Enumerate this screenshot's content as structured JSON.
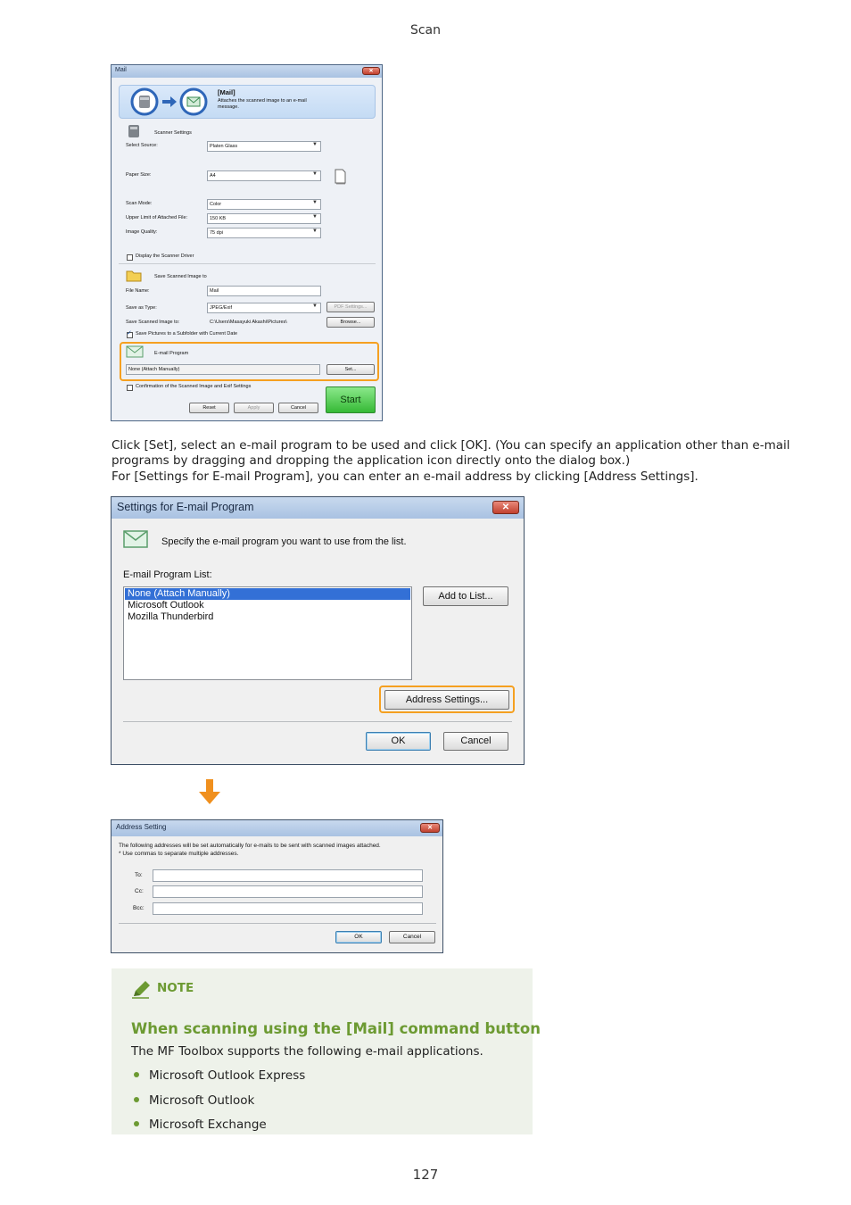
{
  "header": {
    "section": "Scan"
  },
  "mail_dialog": {
    "title": "Mail",
    "close_glyph": "✕",
    "banner_title": "[Mail]",
    "banner_desc_1": "Attaches the scanned image to an e-mail",
    "banner_desc_2": "message.",
    "scanner_settings": "Scanner Settings",
    "select_source_label": "Select Source:",
    "select_source_value": "Platen Glass",
    "paper_size_label": "Paper Size:",
    "paper_size_value": "A4",
    "scan_mode_label": "Scan Mode:",
    "scan_mode_value": "Color",
    "upper_limit_label": "Upper Limit of Attached File:",
    "upper_limit_value": "150 KB",
    "image_quality_label": "Image Quality:",
    "image_quality_value": "75 dpi",
    "display_driver_label": "Display the Scanner Driver",
    "save_scanned_header": "Save Scanned Image to",
    "file_name_label": "File Name:",
    "file_name_value": "Mail",
    "save_as_type_label": "Save as Type:",
    "save_as_type_value": "JPEG/Exif",
    "pdf_settings_button": "PDF Settings...",
    "save_to_label": "Save Scanned Image to:",
    "save_to_value": "C:\\Users\\Masayuki Akashi\\Pictures\\",
    "browse_button": "Browse...",
    "subfolder_label": "Save Pictures to a Subfolder with Current Date",
    "email_program_header": "E-mail Program",
    "email_program_value": "None (Attach Manually)",
    "set_button": "Set...",
    "confirmation_label": "Confirmation of the Scanned Image and Exif Settings",
    "start_button": "Start",
    "reset_button": "Reset",
    "apply_button": "Apply",
    "cancel_button": "Cancel"
  },
  "instructions": {
    "line1": "Click [Set], select an e-mail program to be used and click [OK]. (You can specify an application other than e-mail",
    "line2": "programs by dragging and dropping the application icon directly onto the dialog box.)",
    "line3": "For [Settings for E-mail Program], you can enter an e-mail address by clicking [Address Settings]."
  },
  "settings_dialog": {
    "title": "Settings for E-mail Program",
    "close_glyph": "✕",
    "prompt": "Specify the e-mail program you want to use from the list.",
    "list_label": "E-mail Program List:",
    "programs": [
      "None (Attach Manually)",
      "Microsoft Outlook",
      "Mozilla Thunderbird"
    ],
    "add_to_list_button": "Add to List...",
    "address_settings_button": "Address Settings...",
    "ok_button": "OK",
    "cancel_button": "Cancel"
  },
  "address_dialog": {
    "title": "Address Setting",
    "close_glyph": "✕",
    "desc_1": "The following addresses will be set automatically for e-mails to be sent with scanned images attached.",
    "desc_2": "* Use commas to separate multiple addresses.",
    "to_label": "To:",
    "cc_label": "Cc:",
    "bcc_label": "Bcc:",
    "ok_button": "OK",
    "cancel_button": "Cancel"
  },
  "note": {
    "label": "NOTE",
    "title": "When scanning using the [Mail] command button",
    "text": "The MF Toolbox supports the following e-mail applications.",
    "items": [
      "Microsoft Outlook Express",
      "Microsoft Outlook",
      "Microsoft Exchange"
    ]
  },
  "footer": {
    "page_number": "127"
  },
  "colors": {
    "highlight": "#f5a020",
    "note_accent": "#6c9a32",
    "note_bg": "#eef2ea",
    "start_button": "#4cc94c"
  },
  "icons": [
    "scanner-icon",
    "arrow-right-icon",
    "mail-icon",
    "folder-icon",
    "email-program-icon",
    "paper-icon",
    "pencil-icon",
    "arrow-down-icon"
  ]
}
